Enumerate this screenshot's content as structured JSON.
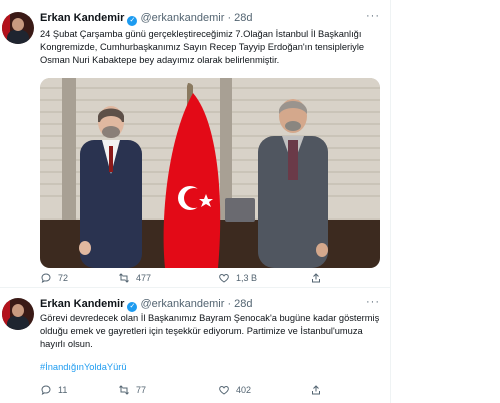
{
  "tweets": [
    {
      "name": "Erkan Kandemir",
      "handle": "@erkankandemir",
      "dot": "·",
      "time": "28d",
      "text": "24 Şubat Çarşamba günü gerçekleştireceğimiz 7.Olağan İstanbul İl Başkanlığı Kongremizde, Cumhurbaşkanımız Sayın Recep Tayyip Erdoğan'ın tensipleriyle Osman Nuri Kabaktepe bey adayımız olarak belirlenmiştir.",
      "replies": "72",
      "retweets": "477",
      "likes": "1,3 B"
    },
    {
      "name": "Erkan Kandemir",
      "handle": "@erkankandemir",
      "dot": "·",
      "time": "28d",
      "text": "Görevi devredecek olan İl Başkanımız Bayram Şenocak'a bugüne kadar göstermiş olduğu emek ve gayretleri için teşekkür ediyorum. Partimize ve İstanbul'umuza hayırlı olsun.",
      "hashtag": "#İnandığınYoldaYürü",
      "replies": "11",
      "retweets": "77",
      "likes": "402"
    }
  ],
  "icons": {
    "verified": "verified-badge-icon",
    "more": "more-horizontal-icon",
    "reply": "reply-icon",
    "retweet": "retweet-icon",
    "like": "heart-icon",
    "share": "share-icon"
  },
  "colors": {
    "accent": "#1d9bf0",
    "text_secondary": "#536471",
    "flag_red": "#e30a17"
  }
}
